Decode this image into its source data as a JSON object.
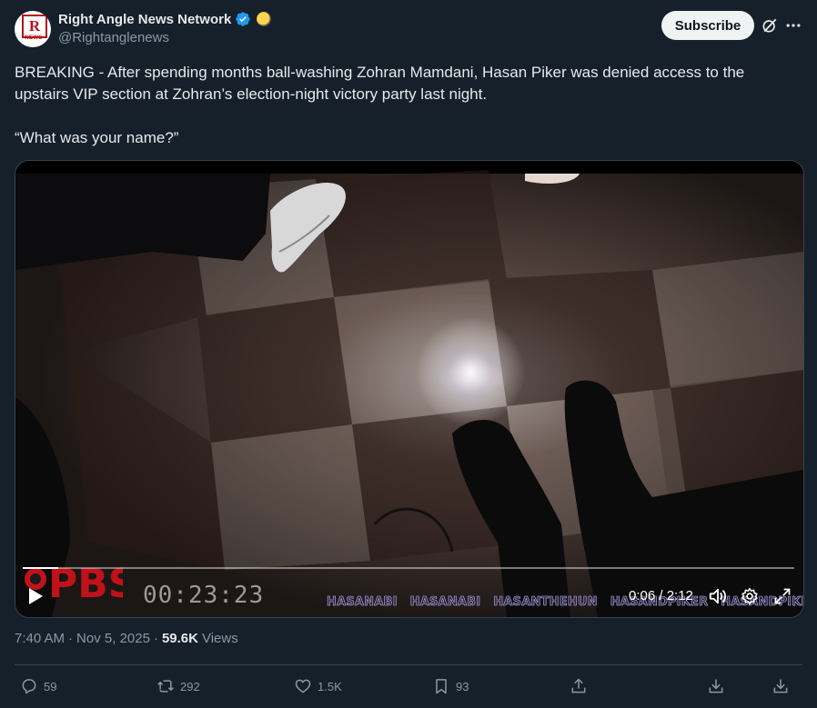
{
  "author": {
    "display_name": "Right Angle News Network",
    "handle": "@Rightanglenews",
    "avatar_text": "R",
    "avatar_subtext": "NEWS"
  },
  "header": {
    "subscribe_label": "Subscribe",
    "grok_icon": "grok-icon",
    "more_icon": "more-icon"
  },
  "tweet": {
    "paragraph1": "BREAKING - After spending months ball-washing Zohran Mamdani, Hasan Piker was denied access to the upstairs VIP section at Zohran’s election-night victory party last night.",
    "paragraph2": "“What was your name?”"
  },
  "video": {
    "overlay_timestamp": "00:23:23",
    "logo_text": "PBS",
    "watermarks": [
      "HASANABI",
      "HASANABI",
      "HASANTHEHUN",
      "HASANDPIKER",
      "HASANDPIKER"
    ],
    "current_time": "0:06",
    "duration": "2:12",
    "time_display": "0:06 / 2:12",
    "progress_fraction": 0.046
  },
  "meta": {
    "time": "7:40 AM",
    "date": "Nov 5, 2025",
    "separator": "·",
    "views_count": "59.6K",
    "views_label": "Views"
  },
  "actions": {
    "replies": "59",
    "reposts": "292",
    "likes": "1.5K",
    "bookmarks": "93"
  },
  "colors": {
    "background": "#15202b",
    "text_primary": "#e7e9ea",
    "text_secondary": "#8b98a5",
    "verified": "#1d9bf0",
    "border": "#38444d"
  }
}
